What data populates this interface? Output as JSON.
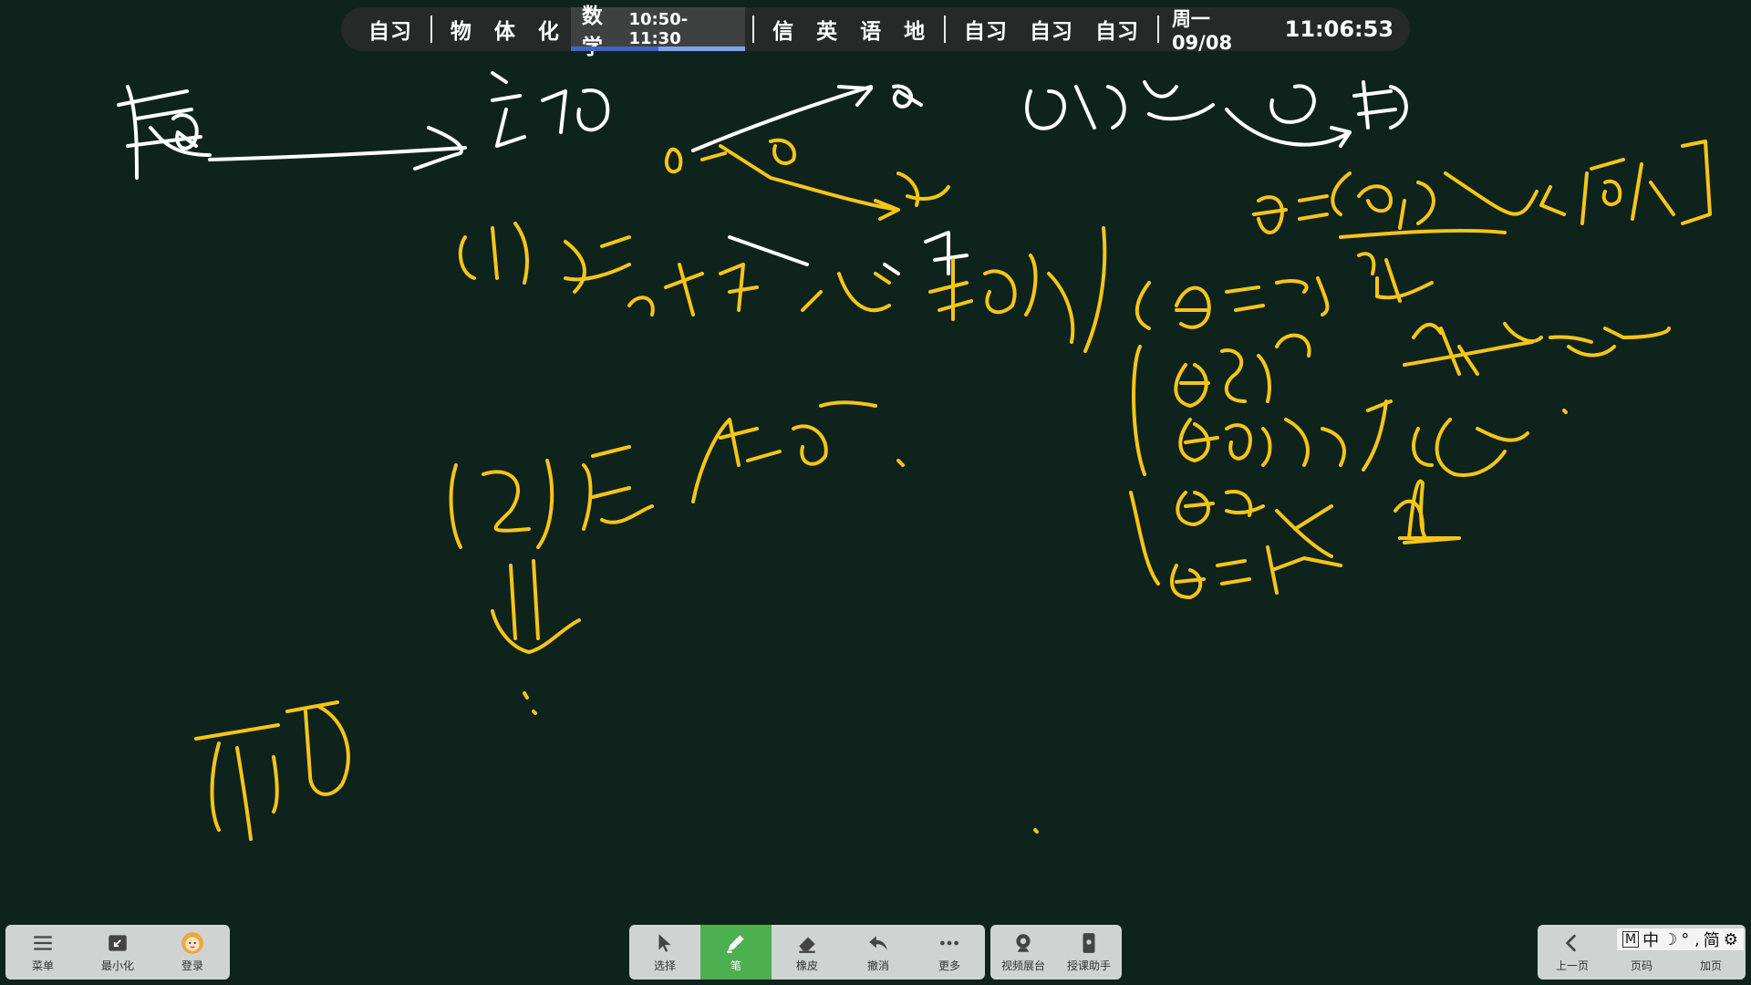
{
  "schedule": {
    "items_before": [
      "自习"
    ],
    "group1": [
      "物",
      "体",
      "化"
    ],
    "current": {
      "subject": "数学",
      "time": "10:50-11:30",
      "progress": 0.5
    },
    "group2": [
      "信",
      "英",
      "语",
      "地"
    ],
    "group3": [
      "自习",
      "自习",
      "自习"
    ],
    "date": "周一 09/08",
    "clock": "11:06:53"
  },
  "toolbar_left": {
    "menu": "菜单",
    "minimize": "最小化",
    "login": "登录"
  },
  "toolbar_center": {
    "select": "选择",
    "pen": "笔",
    "eraser": "橡皮",
    "undo": "撤消",
    "more": "更多"
  },
  "toolbar_mid": {
    "visualizer": "视频展台",
    "assistant": "授课助手"
  },
  "toolbar_right": {
    "prev": "上一页",
    "page": "页码",
    "add": "加页"
  },
  "ime": {
    "mode": "M",
    "lang": "中",
    "symbols": "° ,",
    "simplified": "简"
  },
  "colors": {
    "background": "#0f231d",
    "ink_white": "#ffffff",
    "ink_yellow": "#f5c518",
    "pen_active": "#4caf50"
  },
  "icons": [
    "menu-icon",
    "minimize-icon",
    "avatar-icon",
    "cursor-icon",
    "pen-icon",
    "eraser-icon",
    "undo-icon",
    "more-icon",
    "camera-icon",
    "assistant-icon",
    "chevron-left-icon"
  ]
}
